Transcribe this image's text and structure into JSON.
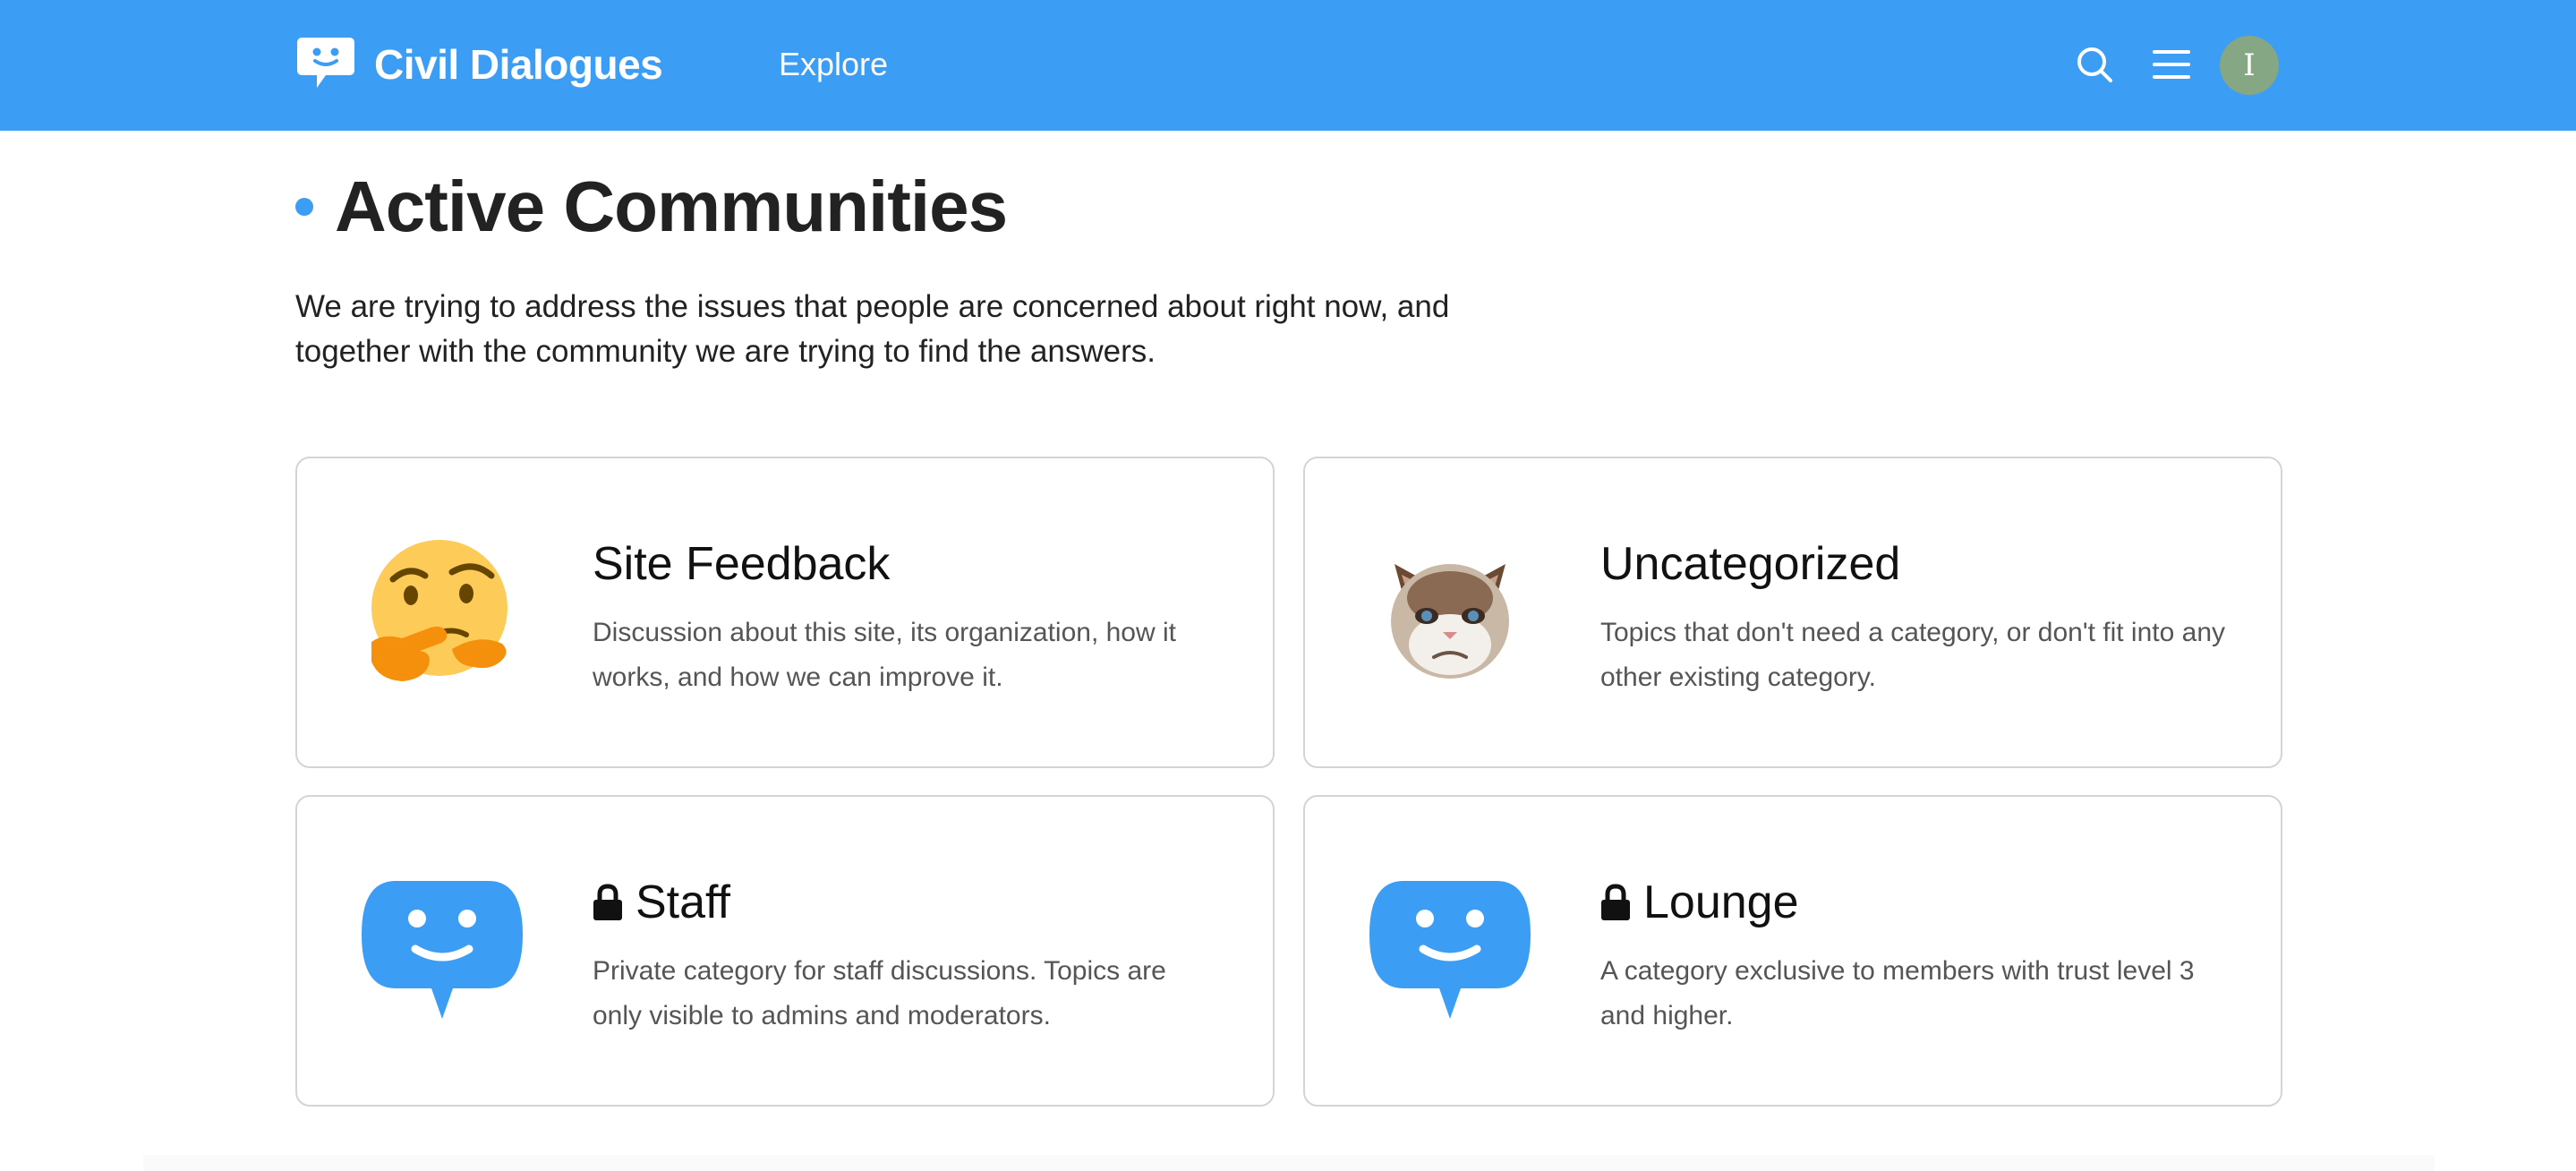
{
  "header": {
    "site_name": "Civil Dialogues",
    "nav_explore": "Explore",
    "avatar_initial": "I",
    "brand_color": "#3c9df4",
    "avatar_color": "#85a784",
    "icons": [
      "speech-bubble-logo-icon",
      "search-icon",
      "hamburger-menu-icon"
    ]
  },
  "page": {
    "title": "Active Communities",
    "intro": "We are trying to address the issues that people are concerned about right now, and together with the community we are trying to find the answers."
  },
  "categories": [
    {
      "name": "Site Feedback",
      "description": "Discussion about this site, its organization, how it works, and how we can improve it.",
      "image": "thinking-face-emoji",
      "locked": false
    },
    {
      "name": "Uncategorized",
      "description": "Topics that don't need a category, or don't fit into any other existing category.",
      "image": "grumpy-cat",
      "locked": false
    },
    {
      "name": "Staff",
      "description": "Private category for staff discussions. Topics are only visible to admins and moderators.",
      "image": "smiley-speech-bubble",
      "locked": true
    },
    {
      "name": "Lounge",
      "description": "A category exclusive to members with trust level 3 and higher.",
      "image": "smiley-speech-bubble",
      "locked": true
    }
  ]
}
